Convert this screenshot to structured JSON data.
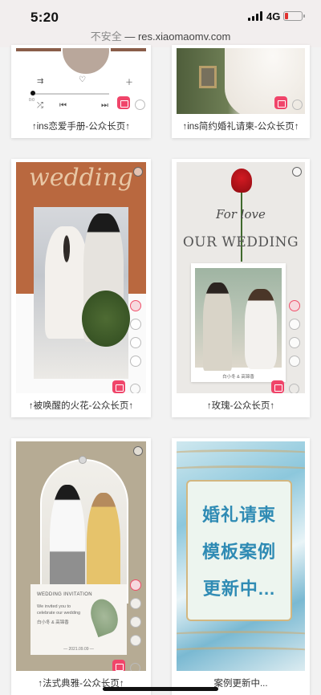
{
  "status_bar": {
    "time": "5:20",
    "network": "4G"
  },
  "url_bar": {
    "security": "不安全",
    "separator": " — ",
    "domain": "res.xiaomaomv.com"
  },
  "cards": [
    {
      "caption": "↑ins恋爱手册-公众长页↑"
    },
    {
      "caption": "↑ins简约婚礼请柬-公众长页↑"
    },
    {
      "caption": "↑被唤醒的火花-公众长页↑",
      "artwork_title": "wedding"
    },
    {
      "caption": "↑玫瑰-公众长页↑",
      "artwork_script": "For love",
      "artwork_title": "OUR WEDDING",
      "artwork_names": "白小冬 & 高锦香"
    },
    {
      "caption": "↑法式典雅-公众长页↑",
      "invitation_title": "WEDDING INVITATION",
      "invitation_body": "We invited you to celebrate our wedding",
      "invitation_names": "白小冬 & 高锦香",
      "invitation_date": "— 2021.09.09 —"
    },
    {
      "caption": "案例更新中...",
      "lines": [
        "婚礼请柬",
        "模板案例",
        "更新中..."
      ]
    }
  ],
  "colors": {
    "accent": "#f0456a",
    "link_blue": "#2f8bb4"
  }
}
